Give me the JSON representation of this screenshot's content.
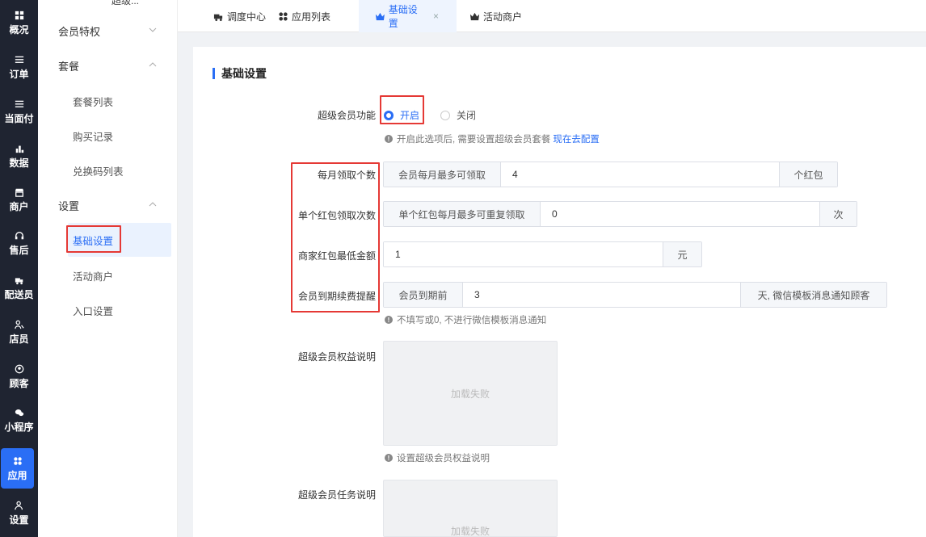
{
  "rail": [
    {
      "label": "概况",
      "icon": "dashboard-icon"
    },
    {
      "label": "订单",
      "icon": "list-icon"
    },
    {
      "label": "当面付",
      "icon": "list-icon"
    },
    {
      "label": "数据",
      "icon": "bar-chart-icon"
    },
    {
      "label": "商户",
      "icon": "store-icon"
    },
    {
      "label": "售后",
      "icon": "headset-icon"
    },
    {
      "label": "配送员",
      "icon": "delivery-icon"
    },
    {
      "label": "店员",
      "icon": "users-icon"
    },
    {
      "label": "顾客",
      "icon": "customer-icon"
    },
    {
      "label": "小程序",
      "icon": "wechat-icon"
    },
    {
      "label": "应用",
      "icon": "apps-icon",
      "active": true
    },
    {
      "label": "设置",
      "icon": "person-settings-icon"
    }
  ],
  "submenu": {
    "cut_top": "超级...",
    "member_privileges": "会员特权",
    "packages": "套餐",
    "package_list": "套餐列表",
    "purchase_records": "购买记录",
    "redeem_codes": "兑换码列表",
    "settings": "设置",
    "basic_settings": "基础设置",
    "active_merchants": "活动商户",
    "entry_settings": "入口设置"
  },
  "tabs": [
    {
      "label": "调度中心",
      "icon": "delivery-icon"
    },
    {
      "label": "应用列表",
      "icon": "apps-icon"
    },
    {
      "label": "基础设置",
      "icon": "crown-icon",
      "active": true,
      "close": "×"
    },
    {
      "label": "活动商户",
      "icon": "crown-icon"
    }
  ],
  "form": {
    "section_title": "基础设置",
    "svip_label": "超级会员功能",
    "radio_on": "开启",
    "radio_off": "关闭",
    "svip_hint": "开启此选项后, 需要设置超级会员套餐",
    "svip_hint_link": "现在去配置",
    "monthly_label": "每月领取个数",
    "monthly_pre": "会员每月最多可领取",
    "monthly_value": "4",
    "monthly_post": "个红包",
    "repeat_label": "单个红包领取次数",
    "repeat_pre": "单个红包每月最多可重复领取",
    "repeat_value": "0",
    "repeat_post": "次",
    "min_label": "商家红包最低金额",
    "min_value": "1",
    "min_post": "元",
    "remind_label": "会员到期续费提醒",
    "remind_pre": "会员到期前",
    "remind_value": "3",
    "remind_post": "天, 微信模板消息通知顾客",
    "remind_hint": "不填写或0, 不进行微信模板消息通知",
    "rights_label": "超级会员权益说明",
    "load_failed": "加载失败",
    "rights_hint": "设置超级会员权益说明",
    "task_label": "超级会员任务说明",
    "load_failed_2": "加载失败"
  },
  "colors": {
    "accent": "#2a6ef5",
    "highlight": "#e53935",
    "rail": "#1f2431"
  }
}
